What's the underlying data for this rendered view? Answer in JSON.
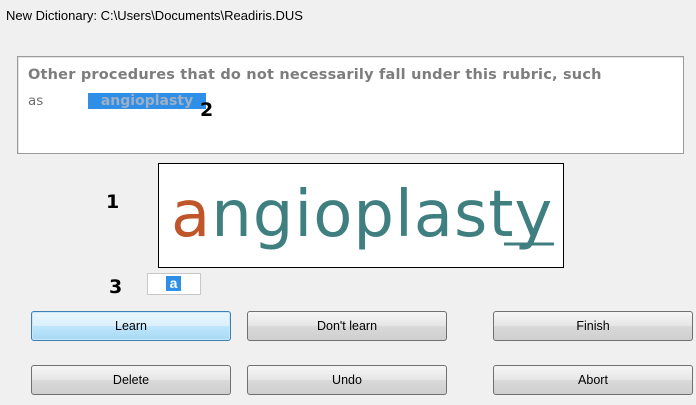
{
  "window": {
    "title": "New Dictionary: C:\\Users\\Documents\\Readiris.DUS"
  },
  "context": {
    "line1": "Other procedures that do not necessarily fall under this rubric, such",
    "line2_prefix": "as",
    "highlighted_word": "angioplasty"
  },
  "word_image": {
    "word": "angioplasty",
    "first_char": "a",
    "rest_chars": "ngioplasty",
    "first_char_color": "#c0552a",
    "rest_color": "#3f7f80"
  },
  "char_field": {
    "value": "a"
  },
  "callouts": {
    "one": "1",
    "two": "2",
    "three": "3"
  },
  "buttons": {
    "learn": "Learn",
    "dont_learn": "Don't learn",
    "finish": "Finish",
    "delete": "Delete",
    "undo": "Undo",
    "abort": "Abort"
  }
}
